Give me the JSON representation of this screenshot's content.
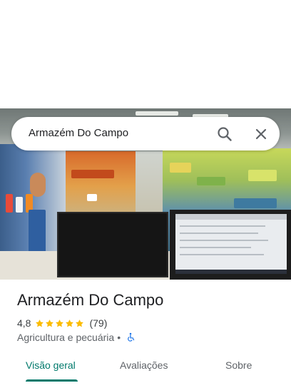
{
  "search": {
    "query": "Armazém Do Campo"
  },
  "place": {
    "title": "Armazém Do Campo",
    "rating": "4,8",
    "stars": 5,
    "review_count": "(79)",
    "category": "Agricultura e pecuária",
    "separator": "•"
  },
  "tabs": [
    {
      "label": "Visão geral",
      "active": true
    },
    {
      "label": "Avaliações",
      "active": false
    },
    {
      "label": "Sobre",
      "active": false
    }
  ],
  "icons": {
    "search": "search-icon",
    "close": "close-icon",
    "star": "star-icon",
    "wheelchair": "wheelchair-accessible-icon"
  },
  "colors": {
    "accent": "#00796b",
    "star": "#fbbc04",
    "wheelchair": "#1a73e8"
  }
}
